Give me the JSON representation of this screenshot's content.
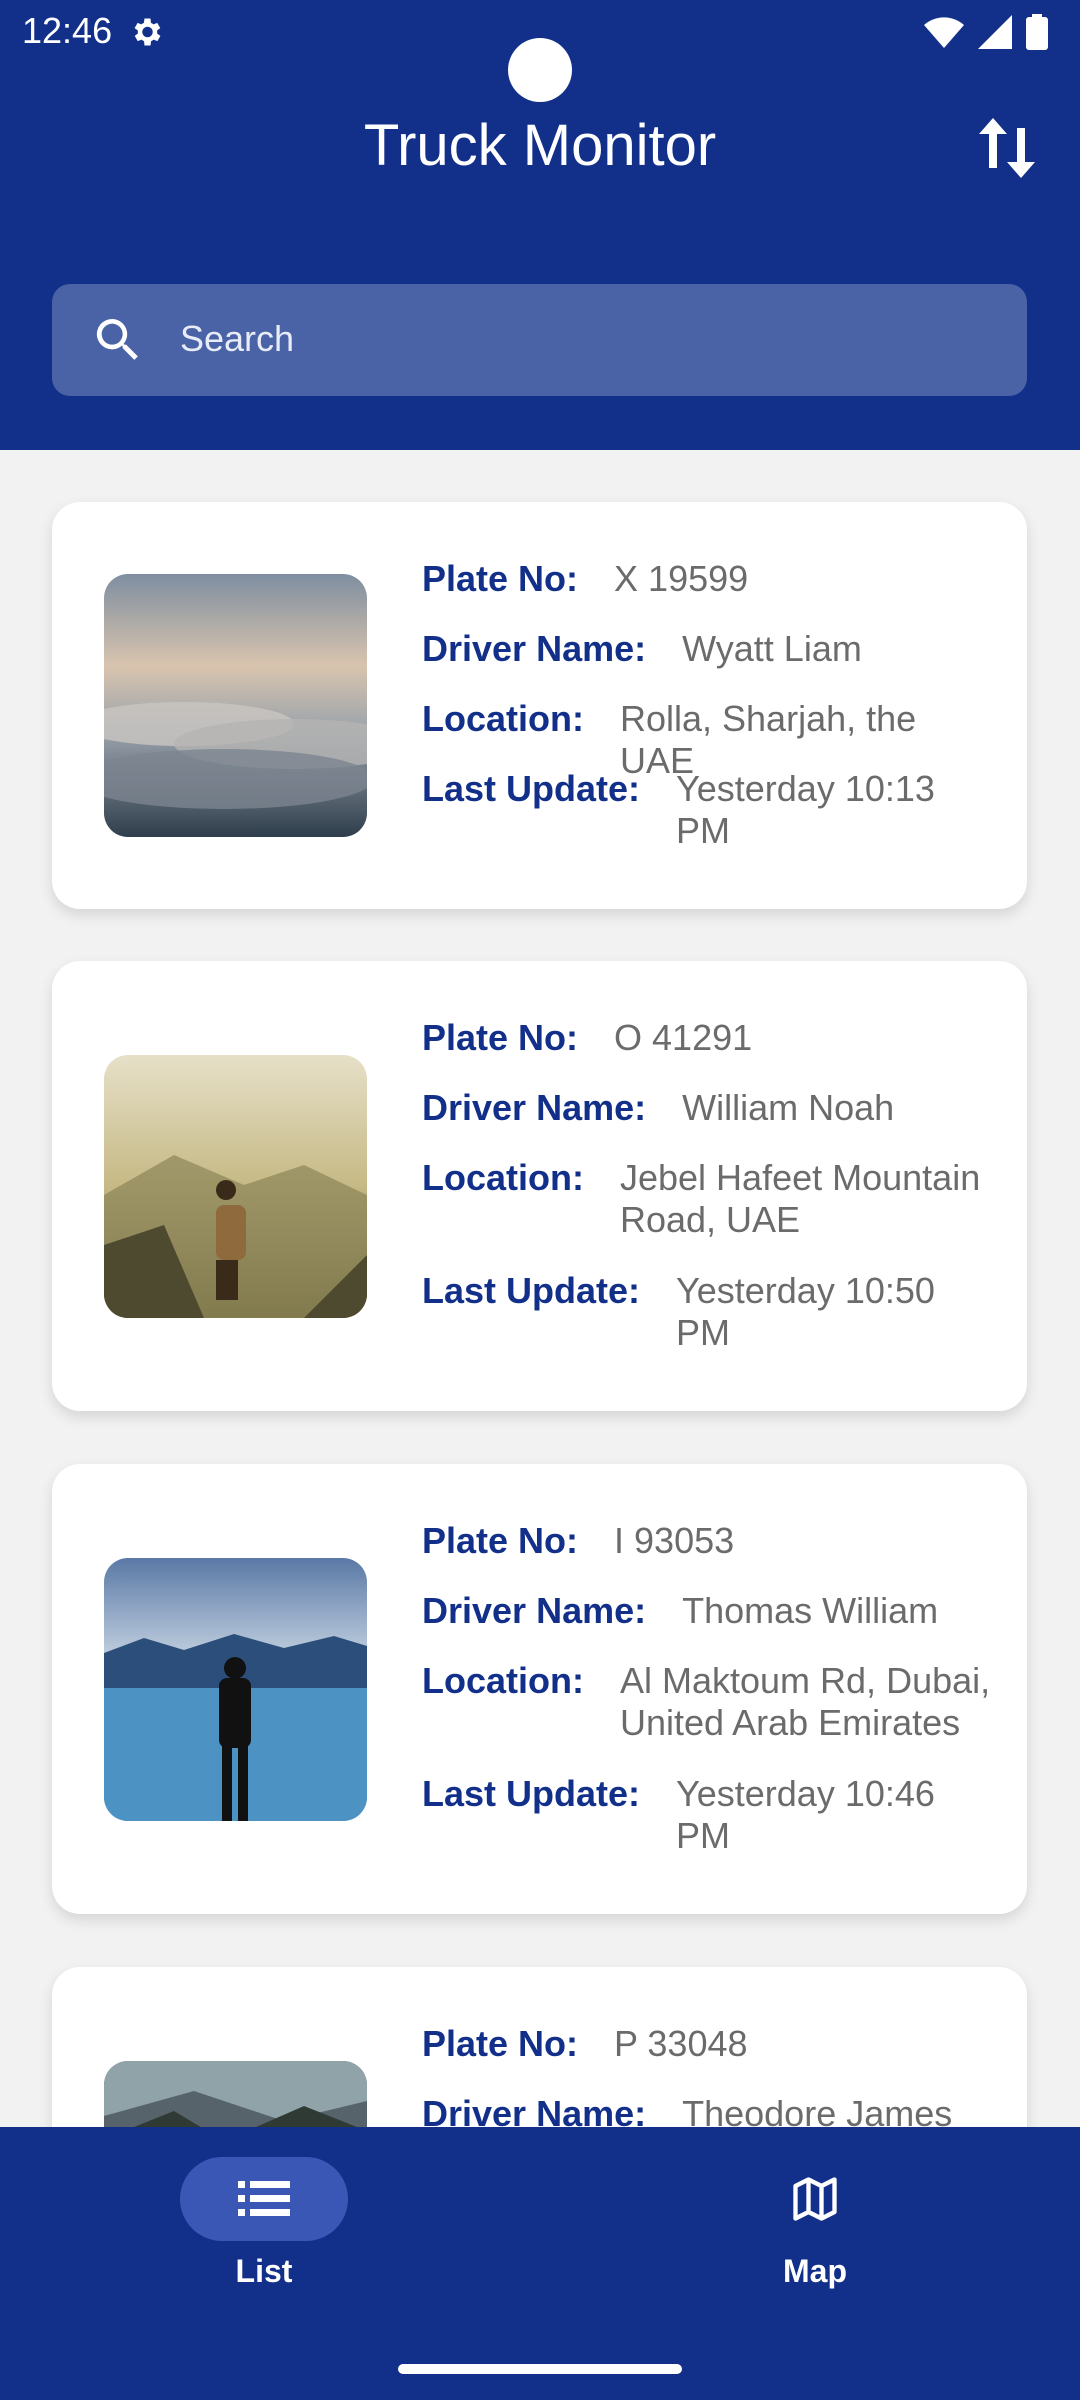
{
  "status": {
    "time": "12:46"
  },
  "header": {
    "title": "Truck Monitor",
    "sort_icon": "sort-arrows-icon"
  },
  "search": {
    "placeholder": "Search"
  },
  "labels": {
    "plate": "Plate No:",
    "driver": "Driver Name:",
    "location": "Location:",
    "update": "Last Update:"
  },
  "trucks": [
    {
      "plate": "X 19599",
      "driver": "Wyatt Liam",
      "location": "Rolla, Sharjah, the UAE",
      "update": "Yesterday 10:13 PM"
    },
    {
      "plate": "O 41291",
      "driver": "William Noah",
      "location": "Jebel Hafeet Mountain Road, UAE",
      "update": "Yesterday 10:50 PM"
    },
    {
      "plate": "I 93053",
      "driver": "Thomas William",
      "location": "Al Maktoum Rd, Dubai, United Arab Emirates",
      "update": "Yesterday 10:46 PM"
    },
    {
      "plate": "P 33048",
      "driver": "Theodore James"
    }
  ],
  "nav": {
    "list_label": "List",
    "map_label": "Map"
  },
  "colors": {
    "primary": "#12308a",
    "search_bg": "#4a62a6",
    "pill": "#3a57b5",
    "label": "#12308a",
    "value": "#6b6b6b"
  }
}
